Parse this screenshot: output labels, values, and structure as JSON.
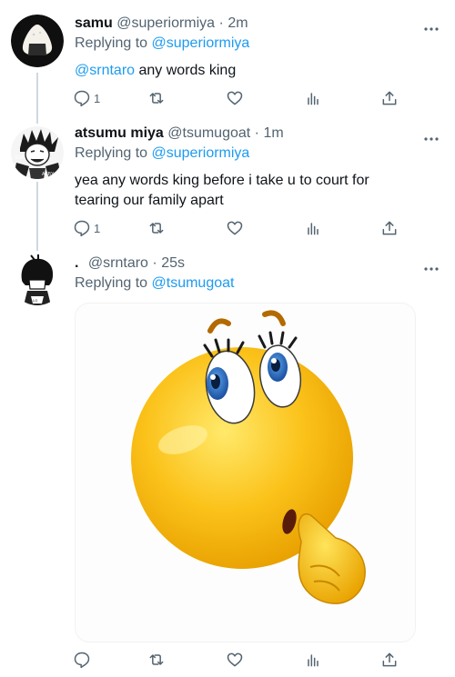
{
  "tweets": [
    {
      "display_name": "samu",
      "handle": "@superiormiya",
      "dot": "·",
      "time": "2m",
      "replying_prefix": "Replying to",
      "replying_to": "@superiormiya",
      "mention": "@srntaro",
      "text": " any words king",
      "reply_count": "1",
      "avatar_icon": "onigiri-avatar"
    },
    {
      "display_name": "atsumu miya",
      "handle": "@tsumugoat",
      "dot": "·",
      "time": "1m",
      "replying_prefix": "Replying to",
      "replying_to": "@superiormiya",
      "text": "yea any words king before i take u to court for tearing our family apart",
      "reply_count": "1",
      "avatar_icon": "manga-character-avatar"
    },
    {
      "display_name": ".",
      "handle": "@srntaro",
      "dot": "·",
      "time": "25s",
      "replying_prefix": "Replying to",
      "replying_to": "@tsumugoat",
      "media_icon": "thinking-emoji",
      "avatar_icon": "manga-character-avatar"
    }
  ],
  "colors": {
    "accent": "#1d9bf0",
    "muted": "#536471",
    "thread_line": "#cfd9de"
  }
}
